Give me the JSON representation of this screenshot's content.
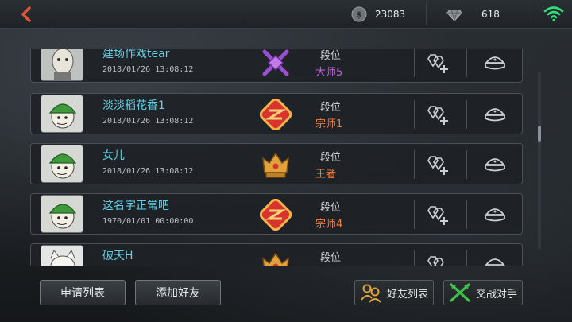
{
  "topbar": {
    "coins": "23083",
    "gems": "618"
  },
  "labels": {
    "rank_label": "段位"
  },
  "friends": [
    {
      "name": "建场作戏tear",
      "date": "2018/01/26  13:08:12",
      "rank": "大师5",
      "rank_tier": "master"
    },
    {
      "name": "淡淡稻花香1",
      "date": "2018/01/26  13:08:12",
      "rank": "宗师1",
      "rank_tier": "grandmaster"
    },
    {
      "name": "女儿",
      "date": "2018/01/26  13:08:12",
      "rank": "王者",
      "rank_tier": "king"
    },
    {
      "name": "这名字正常吧",
      "date": "1970/01/01  00:00:00",
      "rank": "宗师4",
      "rank_tier": "grandmaster"
    },
    {
      "name": "破天H",
      "date": "",
      "rank": "",
      "rank_tier": "king"
    }
  ],
  "bottom": {
    "apply_list": "申请列表",
    "add_friend": "添加好友",
    "friend_list": "好友列表",
    "battle_opponent": "交战对手"
  },
  "colors": {
    "name": "#5fd1e6",
    "rank_orange": "#f07c3a",
    "rank_purple": "#c25fe0",
    "wifi": "#2fe07a"
  }
}
